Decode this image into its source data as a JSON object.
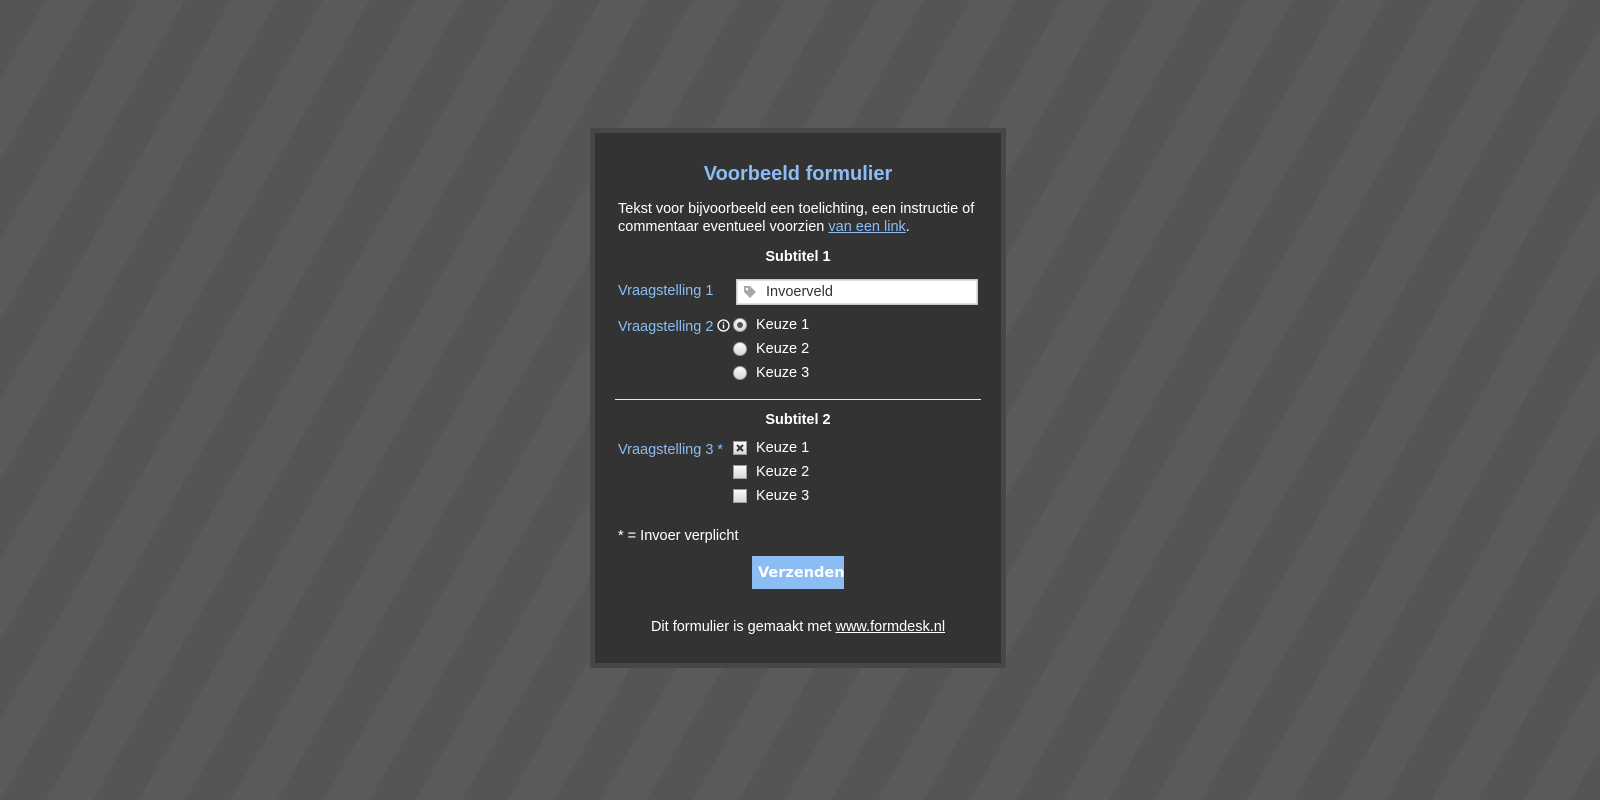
{
  "form": {
    "title": "Voorbeeld formulier",
    "intro_text": "Tekst voor bijvoorbeeld een toelichting, een instructie of commentaar eventueel voorzien ",
    "intro_link": "van een link",
    "intro_end": ".",
    "subtitle1": "Subtitel 1",
    "q1": {
      "label": "Vraagstelling 1",
      "value": "Invoerveld",
      "icon": "tag-icon"
    },
    "q2": {
      "label": "Vraagstelling 2",
      "info_icon": "info-icon",
      "options": [
        "Keuze 1",
        "Keuze 2",
        "Keuze 3"
      ],
      "selected": "Keuze 1"
    },
    "subtitle2": "Subtitel 2",
    "q3": {
      "label": "Vraagstelling 3 *",
      "options": [
        "Keuze 1",
        "Keuze 2",
        "Keuze 3"
      ],
      "checked": [
        "Keuze 1"
      ]
    },
    "required_note": "* = Invoer verplicht",
    "submit_label": "Verzenden",
    "footer_text": "Dit formulier is gemaakt met ",
    "footer_link": "www.formdesk.nl"
  },
  "colors": {
    "accent": "#8bbcf3",
    "card_bg": "#333333",
    "page_bg": "#555555"
  }
}
